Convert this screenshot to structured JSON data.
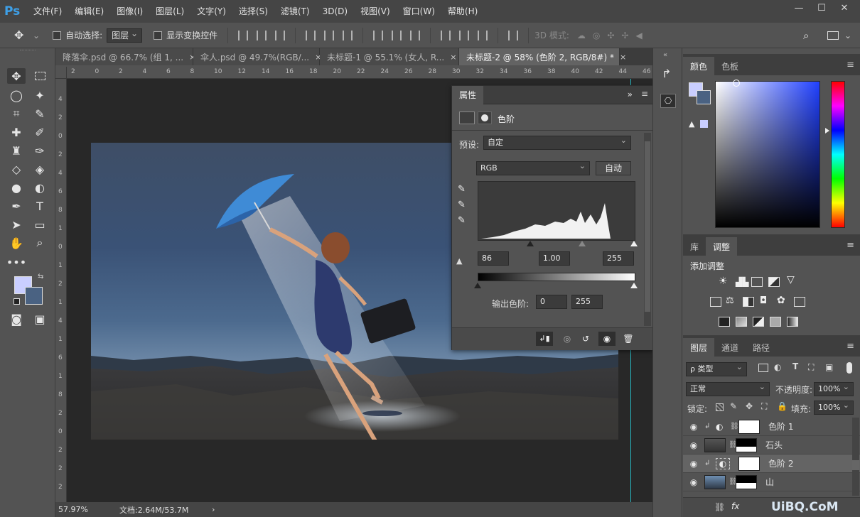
{
  "app": {
    "logo": "Ps"
  },
  "menu": [
    "文件(F)",
    "编辑(E)",
    "图像(I)",
    "图层(L)",
    "文字(Y)",
    "选择(S)",
    "滤镜(T)",
    "3D(D)",
    "视图(V)",
    "窗口(W)",
    "帮助(H)"
  ],
  "window_controls": {
    "minimize": "—",
    "maximize": "☐",
    "close": "✕"
  },
  "options": {
    "auto_select_label": "自动选择:",
    "auto_select_value": "图层",
    "show_transform_label": "显示变换控件",
    "mode_3d_label": "3D 模式:"
  },
  "tabs": [
    {
      "label": "降落伞.psd @ 66.7% (组 1, ...",
      "close": "×"
    },
    {
      "label": "伞人.psd @ 49.7%(RGB/...",
      "close": "×"
    },
    {
      "label": "未标题-1 @ 55.1% (女人, R...",
      "close": "×"
    },
    {
      "label": "未标题-2 @ 58% (色阶 2, RGB/8#) *",
      "close": "×"
    }
  ],
  "ruler_h": [
    "2",
    "0",
    "2",
    "4",
    "6",
    "8",
    "10",
    "12",
    "14",
    "16",
    "18",
    "20",
    "22",
    "24",
    "26",
    "28",
    "30",
    "32",
    "34",
    "36",
    "38",
    "40",
    "42",
    "44",
    "46"
  ],
  "ruler_v": [
    "4",
    "2",
    "0",
    "2",
    "4",
    "6",
    "8",
    "1",
    "0",
    "1",
    "2",
    "1",
    "4",
    "1",
    "6",
    "1",
    "8",
    "2",
    "0",
    "2",
    "2",
    "2"
  ],
  "status": {
    "zoom": "57.97%",
    "doc": "文档:2.64M/53.7M",
    "arrow": "›"
  },
  "properties": {
    "tab": "属性",
    "expand": "»",
    "title": "色阶",
    "preset_label": "预设:",
    "preset_value": "自定",
    "channel": "RGB",
    "auto_btn": "自动",
    "input_black": "86",
    "input_gamma": "1.00",
    "input_white": "255",
    "output_label": "输出色阶:",
    "output_black": "0",
    "output_white": "255"
  },
  "color_panel": {
    "tabs": [
      "颜色",
      "色板"
    ]
  },
  "adjust_panel": {
    "tabs": [
      "库",
      "调整"
    ],
    "add_label": "添加调整"
  },
  "layers_panel": {
    "tabs": [
      "图层",
      "通道",
      "路径"
    ],
    "filter_value": "ρ 类型",
    "blend_mode": "正常",
    "opacity_label": "不透明度:",
    "opacity_value": "100%",
    "lock_label": "锁定:",
    "fill_label": "填充:",
    "fill_value": "100%",
    "layers": [
      {
        "name": "色阶 1",
        "type": "adjustment",
        "selected": false
      },
      {
        "name": "石头",
        "type": "image",
        "selected": false
      },
      {
        "name": "色阶 2",
        "type": "adjustment",
        "selected": true
      },
      {
        "name": "山",
        "type": "image",
        "selected": false
      }
    ],
    "footer": "fx"
  },
  "watermark": "UiBQ.CoM",
  "colors": {
    "foreground": "#c9ceff",
    "background": "#4a6282",
    "accent": "#3ea0e8",
    "guide": "#28b9c3"
  }
}
